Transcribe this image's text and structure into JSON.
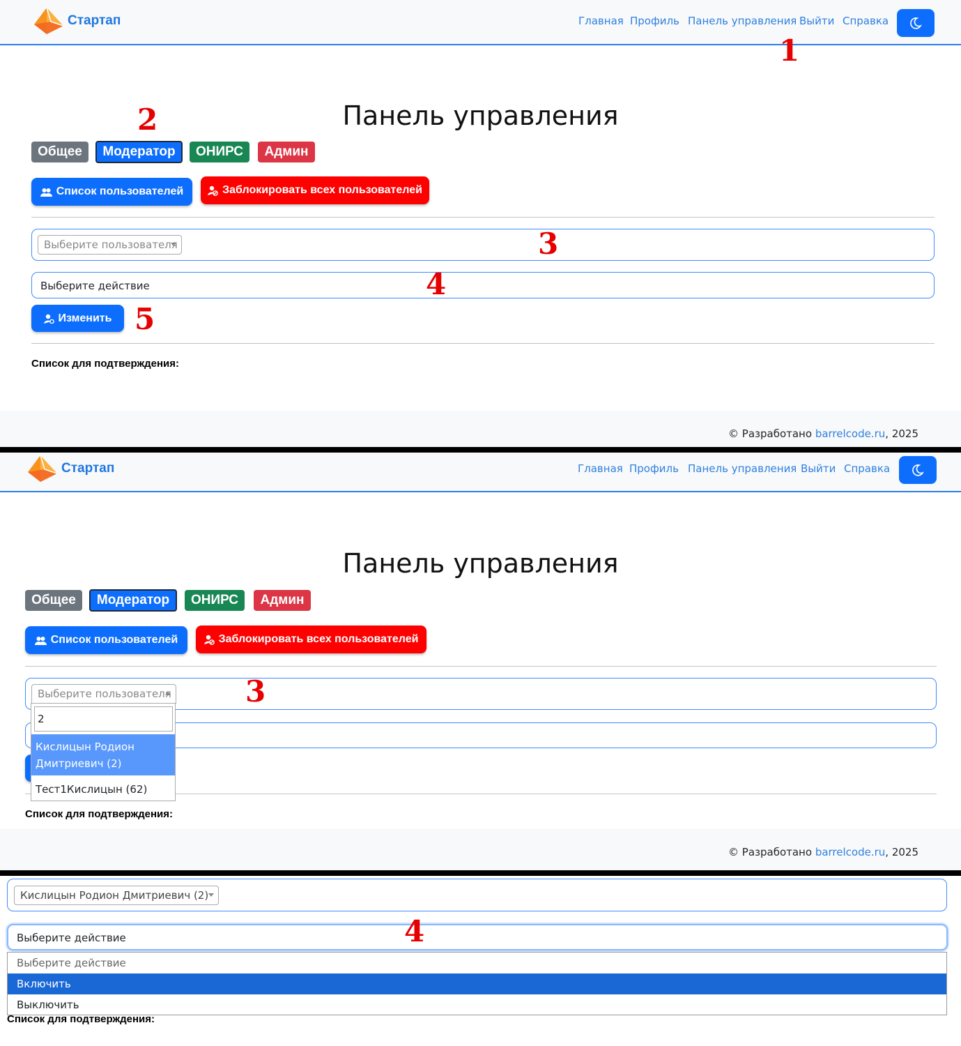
{
  "brand": "Стартап",
  "nav": {
    "links": [
      "Главная",
      "Профиль",
      "Панель управления",
      "Выйти",
      "Справка"
    ],
    "theme_icon": "moon-icon"
  },
  "page_title": "Панель управления",
  "tabs": [
    "Общее",
    "Модератор",
    "ОНИРС",
    "Админ"
  ],
  "buttons": {
    "user_list": "Список пользователей",
    "block_all": "Заблокировать всех пользователей",
    "change": "Изменить"
  },
  "user_select": {
    "placeholder": "Выберите пользователя",
    "search_value": "2",
    "results": [
      "Кислицын Родион Дмитриевич (2)",
      "Тест1Кислицын (62)"
    ],
    "selected": "Кислицын Родион Дмитриевич (2)"
  },
  "action_select": {
    "placeholder": "Выберите действие",
    "options": [
      "Выберите действие",
      "Включить",
      "Выключить"
    ]
  },
  "confirm_label": "Список для подтверждения:",
  "footer": {
    "prefix": "© Разработано ",
    "link": "barrelcode.ru",
    "suffix": ", 2025"
  },
  "markers": {
    "m1": "1",
    "m2": "2",
    "m3": "3",
    "m4": "4",
    "m5": "5"
  },
  "colors": {
    "primary": "#0d6efd",
    "danger": "#ff0000",
    "success": "#198754",
    "secondary": "#6c757d",
    "admin": "#dc3545",
    "marker": "#e60000"
  }
}
